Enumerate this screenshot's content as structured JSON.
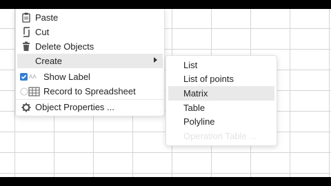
{
  "context_menu": {
    "items": [
      {
        "label": "Paste",
        "icon": "clipboard-icon"
      },
      {
        "label": "Cut",
        "icon": "scissors-icon"
      },
      {
        "label": "Delete Objects",
        "icon": "trash-icon"
      },
      {
        "label": "Create",
        "icon": "",
        "has_submenu": true
      },
      {
        "label": "Show Label",
        "icon": "checkbox-icon",
        "checked": true,
        "prefix": "AA"
      },
      {
        "label": "Record to Spreadsheet",
        "icon": "spreadsheet-icon",
        "checked": false
      },
      {
        "label": "Object Properties ...",
        "icon": "gear-icon"
      }
    ]
  },
  "create_submenu": {
    "items": [
      {
        "label": "List"
      },
      {
        "label": "List of points"
      },
      {
        "label": "Matrix"
      },
      {
        "label": "Table"
      },
      {
        "label": "Polyline"
      },
      {
        "label": "Operation Table ..."
      }
    ],
    "highlighted_index": 2
  },
  "colors": {
    "checkbox_blue": "#2f7fd6",
    "highlight": "#e9e9e9",
    "grid": "#d4d4d4"
  }
}
